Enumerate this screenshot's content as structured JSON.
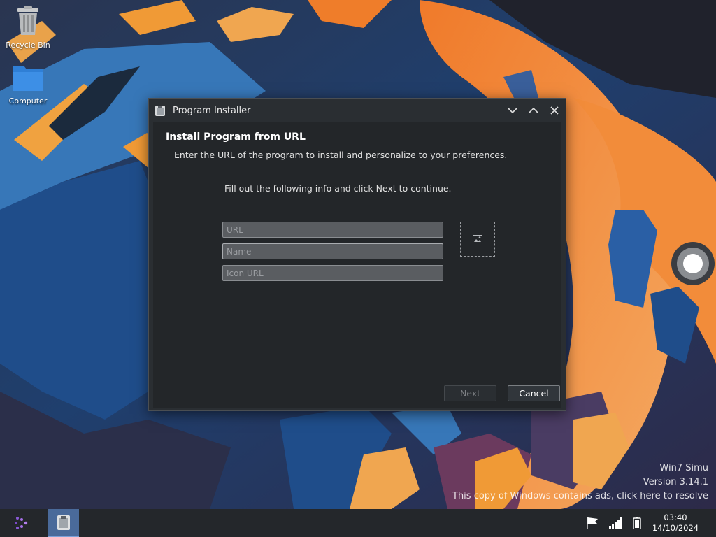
{
  "desktop": {
    "icons": [
      {
        "label": "Recycle Bin"
      },
      {
        "label": "Computer"
      }
    ],
    "watermark": {
      "line1": "Win7 Simu",
      "line2": "Version 3.14.1",
      "line3": "This copy of Windows contains ads, click here to resolve"
    }
  },
  "dialog": {
    "title": "Program Installer",
    "heading": "Install Program from URL",
    "subtext": "Enter the URL of the program to install and personalize to your preferences.",
    "instruction": "Fill out the following info and click Next to continue.",
    "fields": {
      "url": {
        "value": "",
        "placeholder": "URL"
      },
      "name": {
        "value": "",
        "placeholder": "Name"
      },
      "icon_url": {
        "value": "",
        "placeholder": "Icon URL"
      }
    },
    "next_label": "Next",
    "cancel_label": "Cancel"
  },
  "taskbar": {
    "time": "03:40",
    "date": "14/10/2024"
  },
  "colors": {
    "dialog_bg": "#2a2e32",
    "content_bg": "#232629",
    "taskbar_bg": "#24272b",
    "task_active": "#4a6a9a"
  }
}
